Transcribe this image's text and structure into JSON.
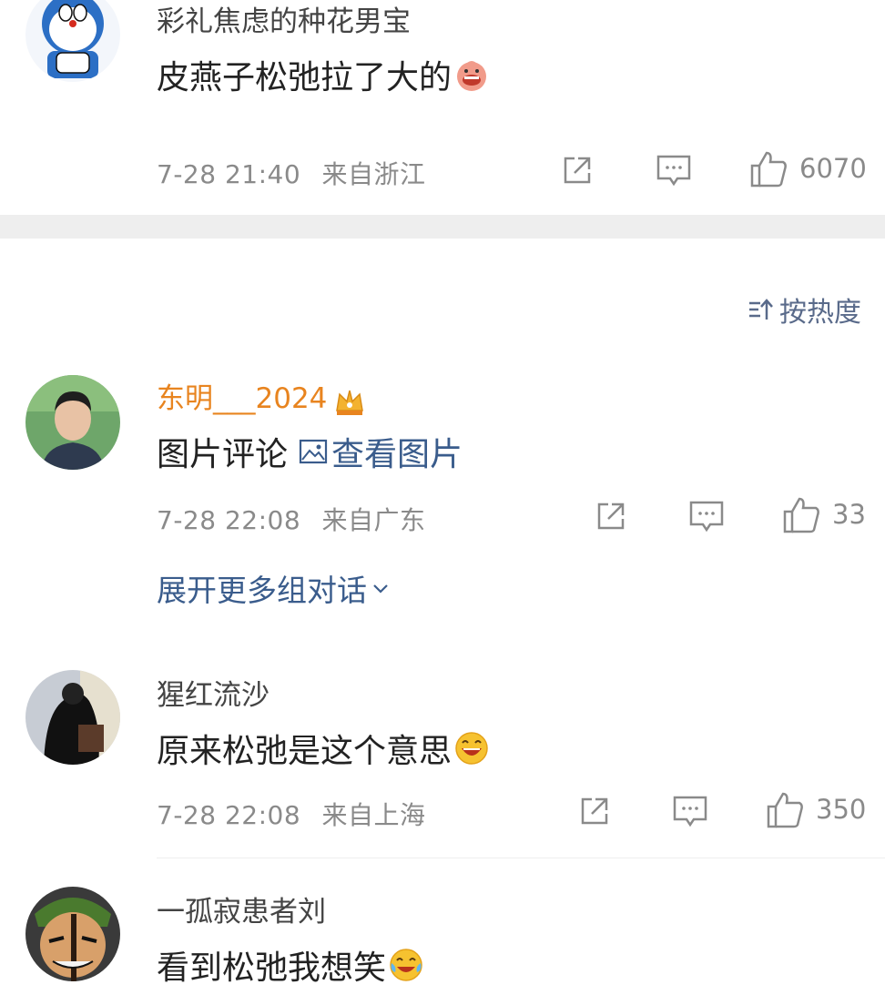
{
  "comments": [
    {
      "username": "彩礼焦虑的种花男宝",
      "text": "皮燕子松弛拉了大的",
      "emoji": "grinning-pink-emoji",
      "date": "7-28 21:40",
      "location": "来自浙江",
      "likes": "6070"
    },
    {
      "username": "东明___2024",
      "text": "图片评论",
      "image_link": "查看图片",
      "date": "7-28 22:08",
      "location": "来自广东",
      "likes": "33"
    },
    {
      "username": "猩红流沙",
      "text": "原来松弛是这个意思",
      "emoji": "laughing-emoji",
      "date": "7-28 22:08",
      "location": "来自上海",
      "likes": "350"
    },
    {
      "username": "一孤寂患者刘",
      "text": "看到松弛我想笑",
      "emoji": "tears-of-joy-emoji"
    }
  ],
  "sort_label": "按热度",
  "expand_label": "展开更多组对话",
  "colors": {
    "vip_name": "#e8841f",
    "link": "#3a5c8c",
    "meta": "#8a8a8a",
    "separator": "#eeeeee"
  }
}
